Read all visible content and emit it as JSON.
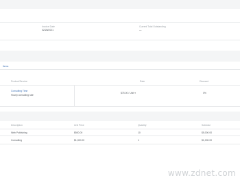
{
  "summary": {
    "field_1": {
      "label": "Invoice Date",
      "value": "02/28/2021"
    },
    "field_2": {
      "label": "Current Total Outstanding",
      "value": "—"
    }
  },
  "section_link": "Items",
  "item_table": {
    "headers": [
      "Product/Service",
      "Rate",
      "Discount"
    ],
    "row": {
      "name": "Consulting Time",
      "description": "Hourly consulting rate",
      "rate": "$75.00 / Unit",
      "discount": "0%"
    }
  },
  "summary_table": {
    "headers": [
      "Description",
      "Unit Price",
      "Quantity",
      "Subtotal"
    ],
    "rows": [
      {
        "description": "Web Publishing",
        "unit_price": "$500.00",
        "quantity": "10",
        "subtotal": "$5,000.00"
      },
      {
        "description": "Consulting",
        "unit_price": "$1,000.00",
        "quantity": "1",
        "subtotal": "$1,000.00"
      }
    ]
  },
  "watermark": "www.zdnet.com",
  "colors": {
    "link": "#3a6fb5",
    "band": "#f4f5f6",
    "border": "#e6e8ea"
  }
}
